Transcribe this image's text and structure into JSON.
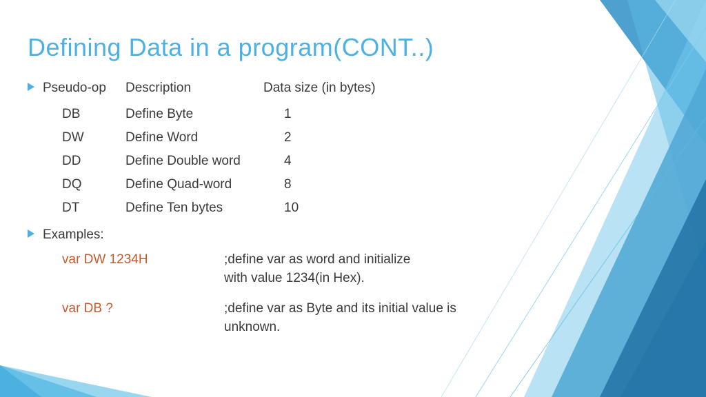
{
  "title": "Defining Data in a program(CONT..)",
  "header": {
    "op": "Pseudo-op",
    "desc": "Description",
    "size": "Data size (in bytes)"
  },
  "rows": [
    {
      "op": "DB",
      "desc": "Define Byte",
      "size": "1"
    },
    {
      "op": "DW",
      "desc": "Define Word",
      "size": "2"
    },
    {
      "op": "DD",
      "desc": "Define Double word",
      "size": "4"
    },
    {
      "op": "DQ",
      "desc": "Define Quad-word",
      "size": "8"
    },
    {
      "op": "DT",
      "desc": "Define Ten bytes",
      "size": "10"
    }
  ],
  "examples_label": "Examples:",
  "examples": [
    {
      "code": "var   DW  1234H",
      "comment": ";define var as word and initialize\n  with value 1234(in Hex)."
    },
    {
      "code": "var DB  ?",
      "comment": ";define var as Byte and its initial value is unknown."
    }
  ]
}
